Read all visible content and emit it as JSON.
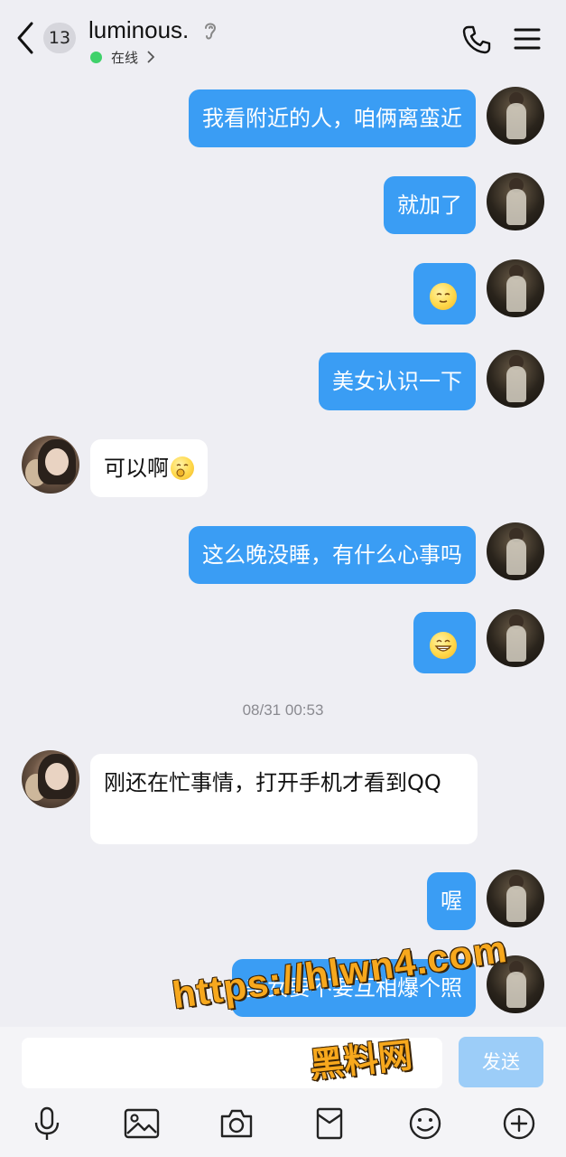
{
  "header": {
    "unread_count": "13",
    "contact_name": "luminous.",
    "status": "在线"
  },
  "messages": [
    {
      "sender": "me",
      "text": "我看附近的人，咱俩离蛮近"
    },
    {
      "sender": "me",
      "text": "就加了"
    },
    {
      "sender": "me",
      "emoji": "hehe-emoji"
    },
    {
      "sender": "me",
      "text": "美女认识一下"
    },
    {
      "sender": "her",
      "text": "可以啊",
      "emoji": "shy-emoji"
    },
    {
      "sender": "me",
      "text": "这么晚没睡，有什么心事吗"
    },
    {
      "sender": "me",
      "emoji": "grin-emoji"
    },
    {
      "sender": "her",
      "text": "刚还在忙事情，打开手机才看到QQ"
    },
    {
      "sender": "me",
      "text": "喔"
    },
    {
      "sender": "me",
      "text": "美女要不要互相爆个照"
    }
  ],
  "timestamp": "08/31 00:53",
  "input": {
    "placeholder": "",
    "send_label": "发送"
  },
  "watermark": {
    "line1": "https://hlwn4.com",
    "line2": "黑料网"
  },
  "colors": {
    "my_bubble": "#3a9df4",
    "her_bubble": "#ffffff",
    "online_dot": "#3fd16a",
    "send_disabled": "#9ccdf8",
    "watermark": "#f7a81d"
  }
}
